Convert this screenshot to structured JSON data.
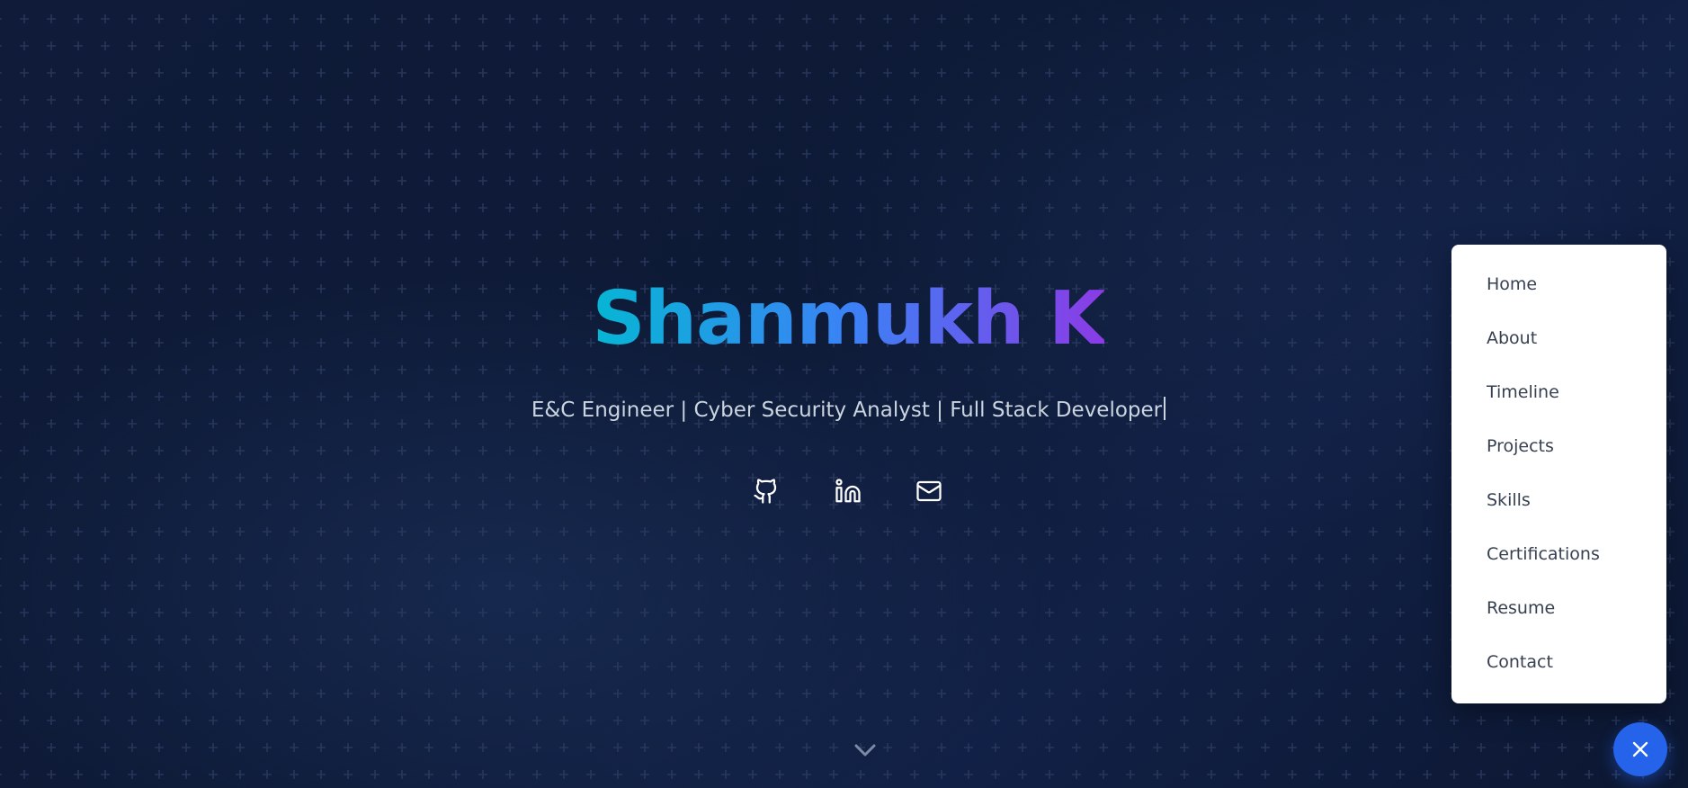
{
  "hero": {
    "name": "Shanmukh K",
    "tagline": "E&C Engineer | Cyber Security Analyst | Full Stack Developer",
    "gradient_colors": [
      "#06b6d4",
      "#3b82f6",
      "#8b3be6"
    ]
  },
  "socials": [
    {
      "icon": "github-icon"
    },
    {
      "icon": "linkedin-icon"
    },
    {
      "icon": "mail-icon"
    }
  ],
  "scroll_indicator": {
    "icon": "chevron-down-icon"
  },
  "menu": {
    "items": [
      {
        "label": "Home"
      },
      {
        "label": "About"
      },
      {
        "label": "Timeline"
      },
      {
        "label": "Projects"
      },
      {
        "label": "Skills"
      },
      {
        "label": "Certifications"
      },
      {
        "label": "Resume"
      },
      {
        "label": "Contact"
      }
    ],
    "close_icon": "close-icon",
    "accent": "#2563eb"
  },
  "colors": {
    "background": "#0f1b38",
    "text_muted": "#cbd5e1",
    "menu_text": "#374151"
  }
}
